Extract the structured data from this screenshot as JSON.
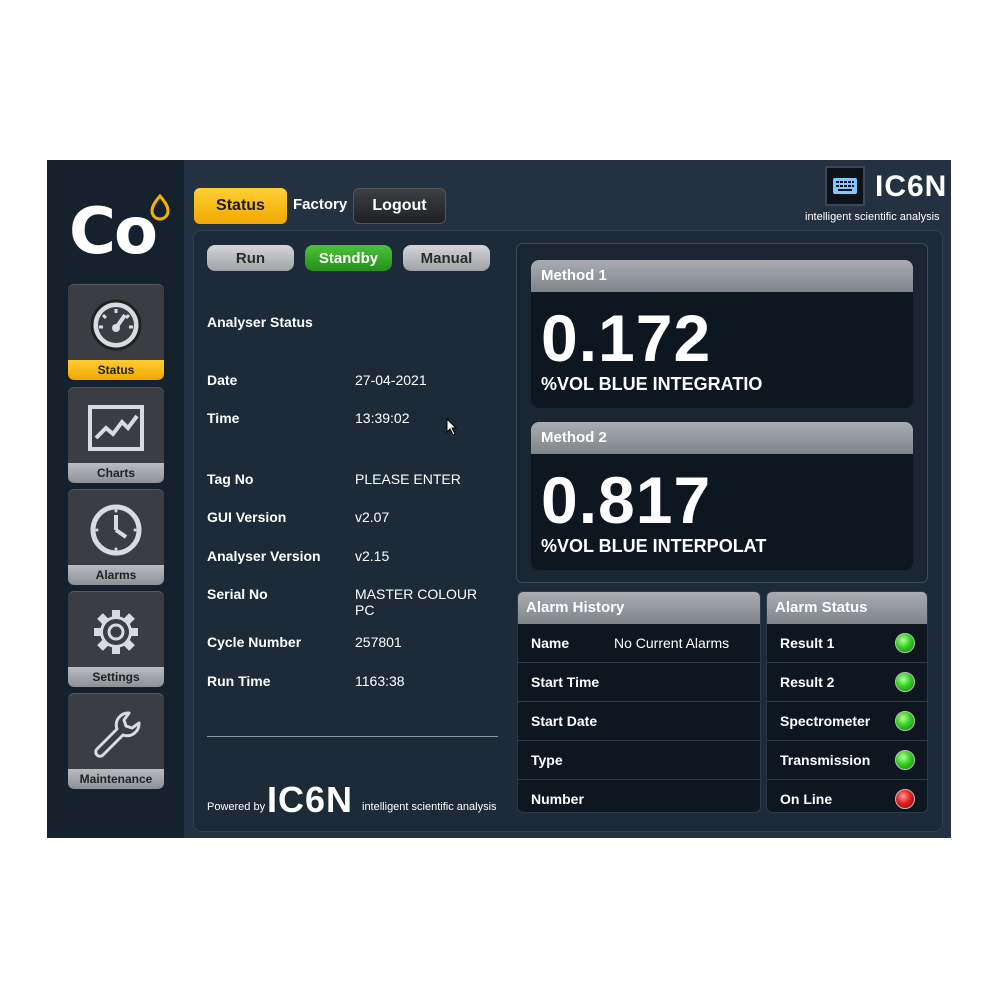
{
  "sidebar": {
    "logo": "Co",
    "items": [
      {
        "label": "Status",
        "icon": "gauge-icon",
        "active": true
      },
      {
        "label": "Charts",
        "icon": "line-chart-icon",
        "active": false
      },
      {
        "label": "Alarms",
        "icon": "clock-icon",
        "active": false
      },
      {
        "label": "Settings",
        "icon": "gear-icon",
        "active": false
      },
      {
        "label": "Maintenance",
        "icon": "wrench-icon",
        "active": false
      }
    ]
  },
  "topbar": {
    "status_label": "Status",
    "factory_label": "Factory",
    "logout_label": "Logout",
    "brand_name": "IC6N",
    "brand_tagline": "intelligent scientific analysis",
    "keyboard_icon": "keyboard-icon"
  },
  "modes": {
    "run": "Run",
    "standby": "Standby",
    "manual": "Manual",
    "active": "Standby"
  },
  "analyser": {
    "heading": "Analyser Status",
    "date_label": "Date",
    "date": "27-04-2021",
    "time_label": "Time",
    "time": "13:39:02",
    "tag_label": "Tag No",
    "tag": "PLEASE ENTER",
    "gui_label": "GUI Version",
    "gui": "v2.07",
    "analyser_label": "Analyser Version",
    "analyser_version": "v2.15",
    "serial_label": "Serial No",
    "serial": "MASTER COLOUR PC",
    "cycle_label": "Cycle Number",
    "cycle": "257801",
    "runtime_label": "Run Time",
    "runtime": "1163:38"
  },
  "footer": {
    "powered": "Powered by",
    "brand": "IC6N",
    "tagline": "intelligent scientific analysis"
  },
  "methods": [
    {
      "title": "Method 1",
      "value": "0.172",
      "unit": "%VOL BLUE INTEGRATIO"
    },
    {
      "title": "Method 2",
      "value": "0.817",
      "unit": "%VOL BLUE INTERPOLAT"
    }
  ],
  "alarm_history": {
    "title": "Alarm History",
    "rows": [
      {
        "label": "Name",
        "value": "No Current Alarms"
      },
      {
        "label": "Start Time",
        "value": ""
      },
      {
        "label": "Start Date",
        "value": ""
      },
      {
        "label": "Type",
        "value": ""
      },
      {
        "label": "Number",
        "value": ""
      }
    ]
  },
  "alarm_status": {
    "title": "Alarm Status",
    "rows": [
      {
        "label": "Result 1",
        "state": "green"
      },
      {
        "label": "Result 2",
        "state": "green"
      },
      {
        "label": "Spectrometer",
        "state": "green"
      },
      {
        "label": "Transmission",
        "state": "green"
      },
      {
        "label": "On Line",
        "state": "red"
      }
    ]
  },
  "colors": {
    "accent": "#f2a700",
    "standby": "#2ea820",
    "ok": "#33d022",
    "fault": "#e21e1e"
  }
}
